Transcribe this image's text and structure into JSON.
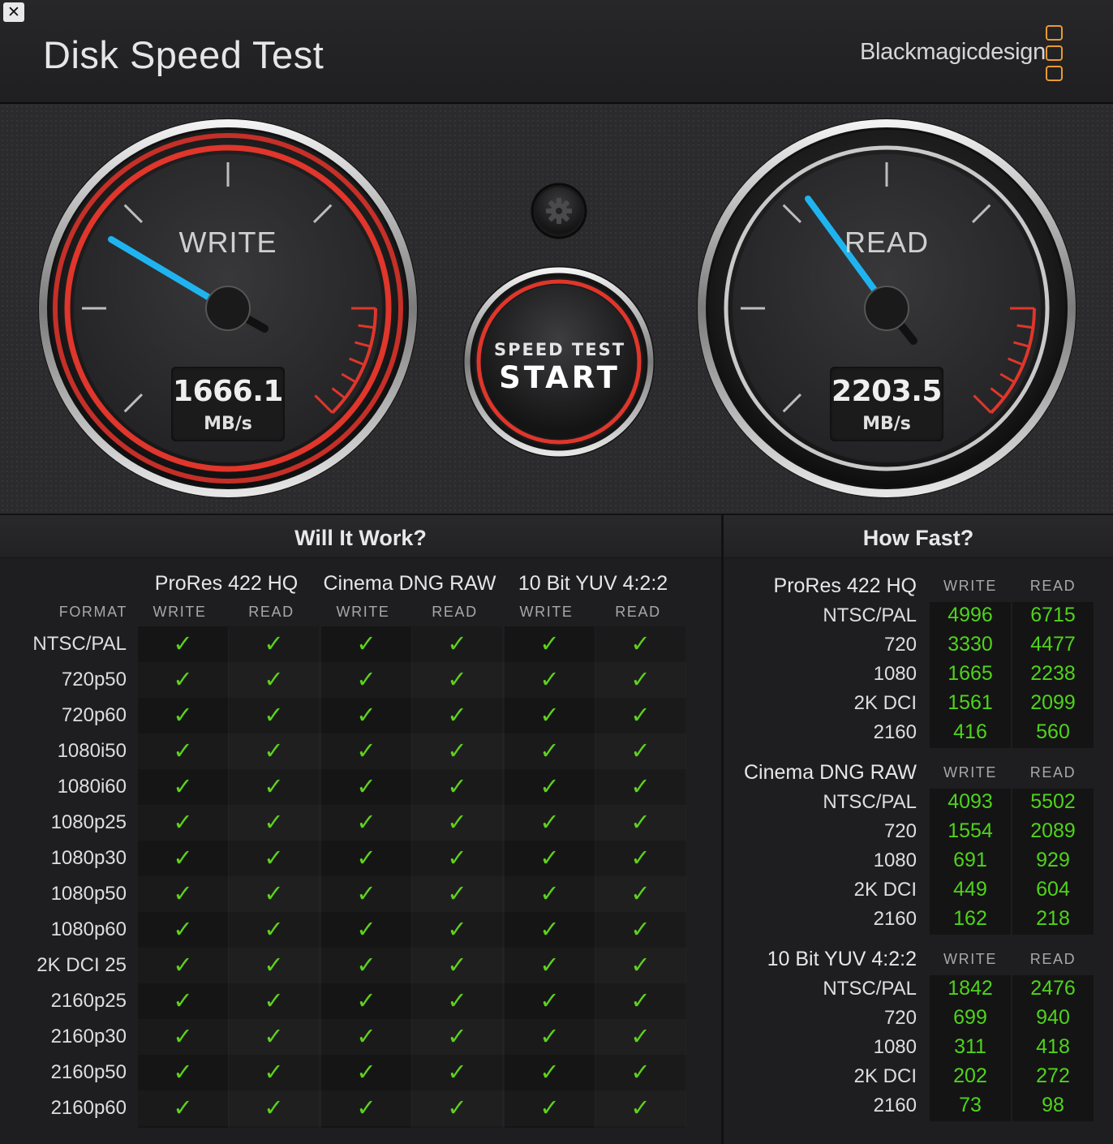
{
  "window": {
    "close_icon": "close-icon",
    "title": "Disk Speed Test"
  },
  "brand": {
    "name": "Blackmagicdesign",
    "accent": "#e89b32"
  },
  "gauges": {
    "write": {
      "label": "WRITE",
      "value": "1666.1",
      "unit": "MB/s",
      "accent": "#d8332a"
    },
    "read": {
      "label": "READ",
      "value": "2203.5",
      "unit": "MB/s",
      "accent": "#c9c9c9"
    },
    "needle_color": "#1fb4f0"
  },
  "start_button": {
    "line1": "SPEED TEST",
    "line2": "START"
  },
  "settings_icon": "gear-icon",
  "will_it_work": {
    "title": "Will It Work?",
    "format_header": "FORMAT",
    "codecs": [
      "ProRes 422 HQ",
      "Cinema DNG RAW",
      "10 Bit YUV 4:2:2"
    ],
    "subheaders": [
      "WRITE",
      "READ"
    ],
    "formats": [
      "NTSC/PAL",
      "720p50",
      "720p60",
      "1080i50",
      "1080i60",
      "1080p25",
      "1080p30",
      "1080p50",
      "1080p60",
      "2K DCI 25",
      "2160p25",
      "2160p30",
      "2160p50",
      "2160p60"
    ],
    "check_glyph": "✓",
    "check_color": "#5ed11c"
  },
  "how_fast": {
    "title": "How Fast?",
    "subheaders": [
      "WRITE",
      "READ"
    ],
    "value_color": "#4fd31a",
    "groups": [
      {
        "codec": "ProRes 422 HQ",
        "rows": [
          {
            "res": "NTSC/PAL",
            "write": "4996",
            "read": "6715"
          },
          {
            "res": "720",
            "write": "3330",
            "read": "4477"
          },
          {
            "res": "1080",
            "write": "1665",
            "read": "2238"
          },
          {
            "res": "2K DCI",
            "write": "1561",
            "read": "2099"
          },
          {
            "res": "2160",
            "write": "416",
            "read": "560"
          }
        ]
      },
      {
        "codec": "Cinema DNG RAW",
        "rows": [
          {
            "res": "NTSC/PAL",
            "write": "4093",
            "read": "5502"
          },
          {
            "res": "720",
            "write": "1554",
            "read": "2089"
          },
          {
            "res": "1080",
            "write": "691",
            "read": "929"
          },
          {
            "res": "2K DCI",
            "write": "449",
            "read": "604"
          },
          {
            "res": "2160",
            "write": "162",
            "read": "218"
          }
        ]
      },
      {
        "codec": "10 Bit YUV 4:2:2",
        "rows": [
          {
            "res": "NTSC/PAL",
            "write": "1842",
            "read": "2476"
          },
          {
            "res": "720",
            "write": "699",
            "read": "940"
          },
          {
            "res": "1080",
            "write": "311",
            "read": "418"
          },
          {
            "res": "2K DCI",
            "write": "202",
            "read": "272"
          },
          {
            "res": "2160",
            "write": "73",
            "read": "98"
          }
        ]
      }
    ]
  }
}
